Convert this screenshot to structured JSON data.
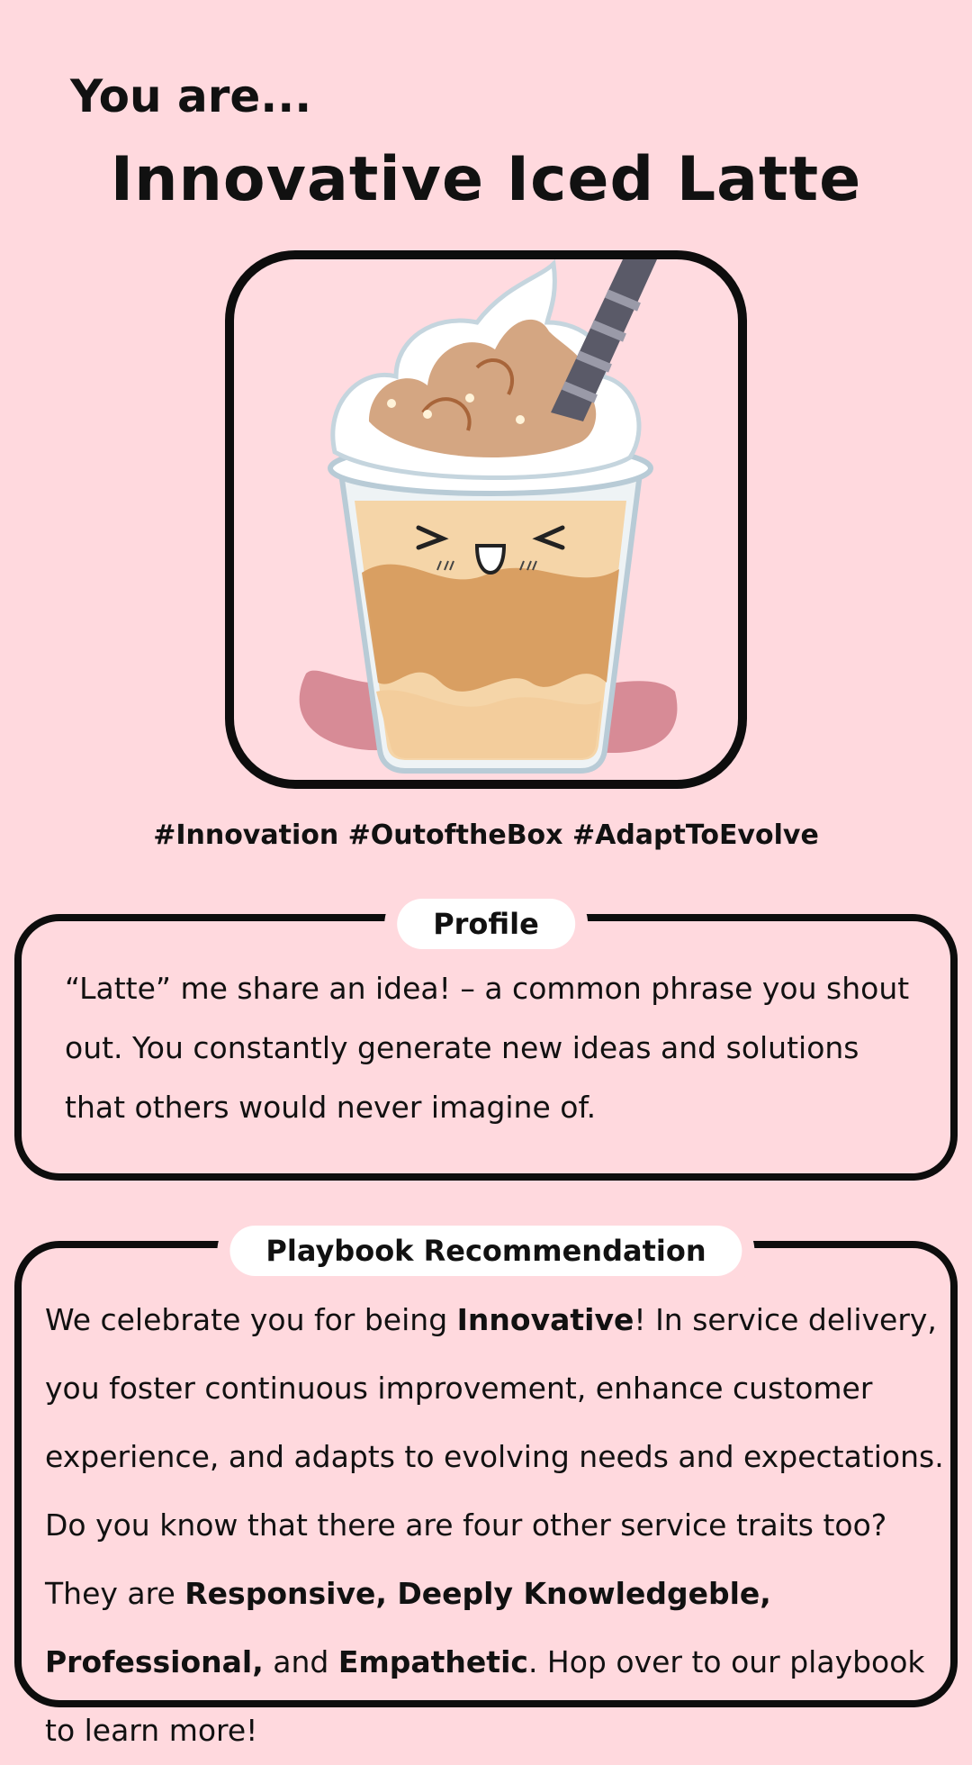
{
  "header": {
    "intro": "You are...",
    "title": "Innovative Iced Latte"
  },
  "hashtags": "#Innovation #OutoftheBox #AdaptToEvolve",
  "profile": {
    "label": "Profile",
    "text": "“Latte” me share an idea! – a common phrase you shout out. You constantly generate new ideas and solutions that others would never imagine of."
  },
  "playbook": {
    "label": "Playbook Recommendation",
    "part1": "We celebrate you for being ",
    "trait": "Innovative",
    "part2": "! In service delivery, you foster continuous improvement, enhance customer experience, and adapts to evolving needs and expectations. Do you know that there are four other service traits too? They are ",
    "other_traits": "Responsive, Deeply Knowledgeble, Professional,",
    "part3": " and ",
    "last_trait": "Empathetic",
    "part4": ". Hop over to our playbook to learn more!"
  },
  "colors": {
    "background": "#ffd9de",
    "frame": "#0d0d0d",
    "label_bg": "#ffffff"
  },
  "icons": {
    "illustration": "iced-latte-illustration"
  }
}
